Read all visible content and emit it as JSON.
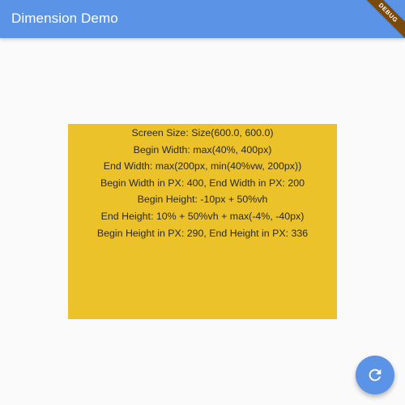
{
  "app": {
    "title": "Dimension Demo",
    "debug_banner": "DEBUG",
    "accent_color": "#5b93e6",
    "box_color": "#ecc22a"
  },
  "info": {
    "lines": [
      "Screen Size: Size(600.0, 600.0)",
      "Begin Width: max(40%, 400px)",
      "End Width: max(200px, min(40%vw, 200px))",
      "Begin Width in PX: 400, End Width in PX: 200",
      "Begin Height: -10px + 50%vh",
      "End Height: 10% + 50%vh + max(-4%, -40px)",
      "Begin Height in PX: 290, End Height in PX: 336"
    ]
  },
  "fab": {
    "icon": "refresh-icon"
  }
}
